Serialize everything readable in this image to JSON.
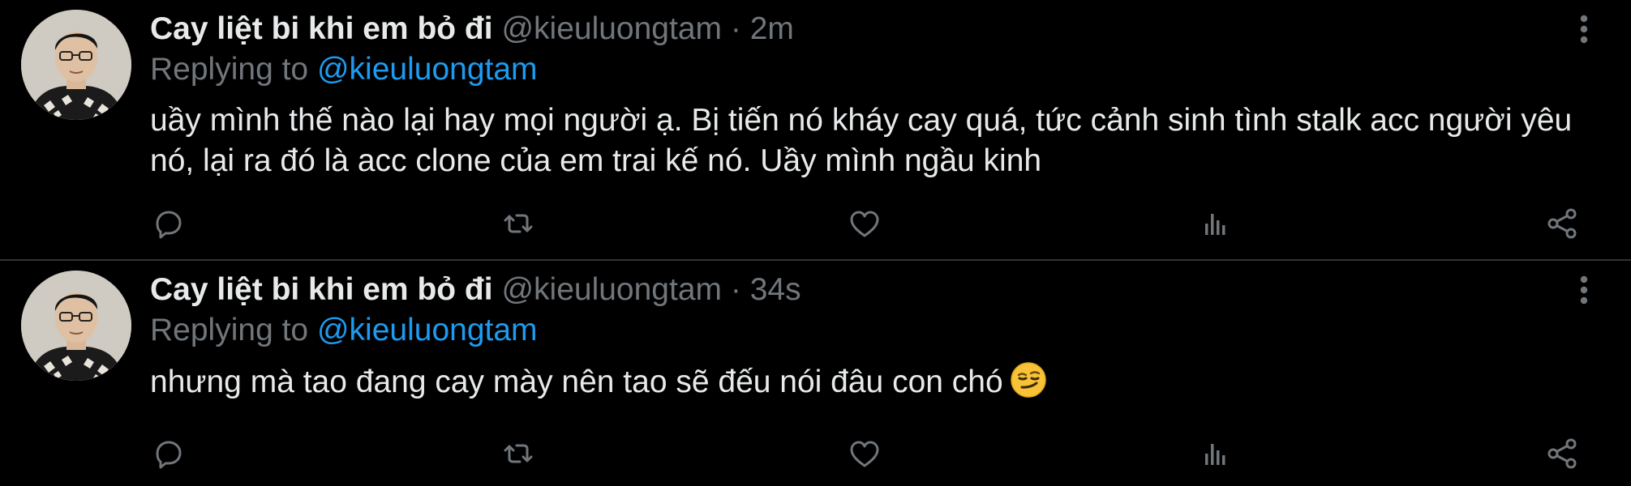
{
  "colors": {
    "background": "#000000",
    "text": "#e7e9ea",
    "muted": "#71767b",
    "link": "#1d9bf0",
    "divider": "#2f3336"
  },
  "tweets": [
    {
      "display_name": "Cay liệt bi khi em bỏ đi",
      "handle": "@kieuluongtam",
      "separator": "·",
      "time": "2m",
      "replying_prefix": "Replying to",
      "replying_handle": "@kieuluongtam",
      "text": "uầy mình thế nào lại hay mọi người ạ. Bị tiến nó kháy cay quá, tức cảnh sinh tình stalk acc người yêu nó, lại ra đó là acc clone của em trai kế nó. Uầy mình ngầu kinh",
      "emoji": "",
      "icons": [
        "more-vertical-icon",
        "reply-icon",
        "retweet-icon",
        "like-icon",
        "views-icon",
        "share-icon"
      ]
    },
    {
      "display_name": "Cay liệt bi khi em bỏ đi",
      "handle": "@kieuluongtam",
      "separator": "·",
      "time": "34s",
      "replying_prefix": "Replying to",
      "replying_handle": "@kieuluongtam",
      "text": "nhưng mà tao đang cay mày nên tao sẽ đếu nói đâu con chó",
      "emoji": "smirking-face-emoji",
      "icons": [
        "more-vertical-icon",
        "reply-icon",
        "retweet-icon",
        "like-icon",
        "views-icon",
        "share-icon"
      ]
    }
  ]
}
